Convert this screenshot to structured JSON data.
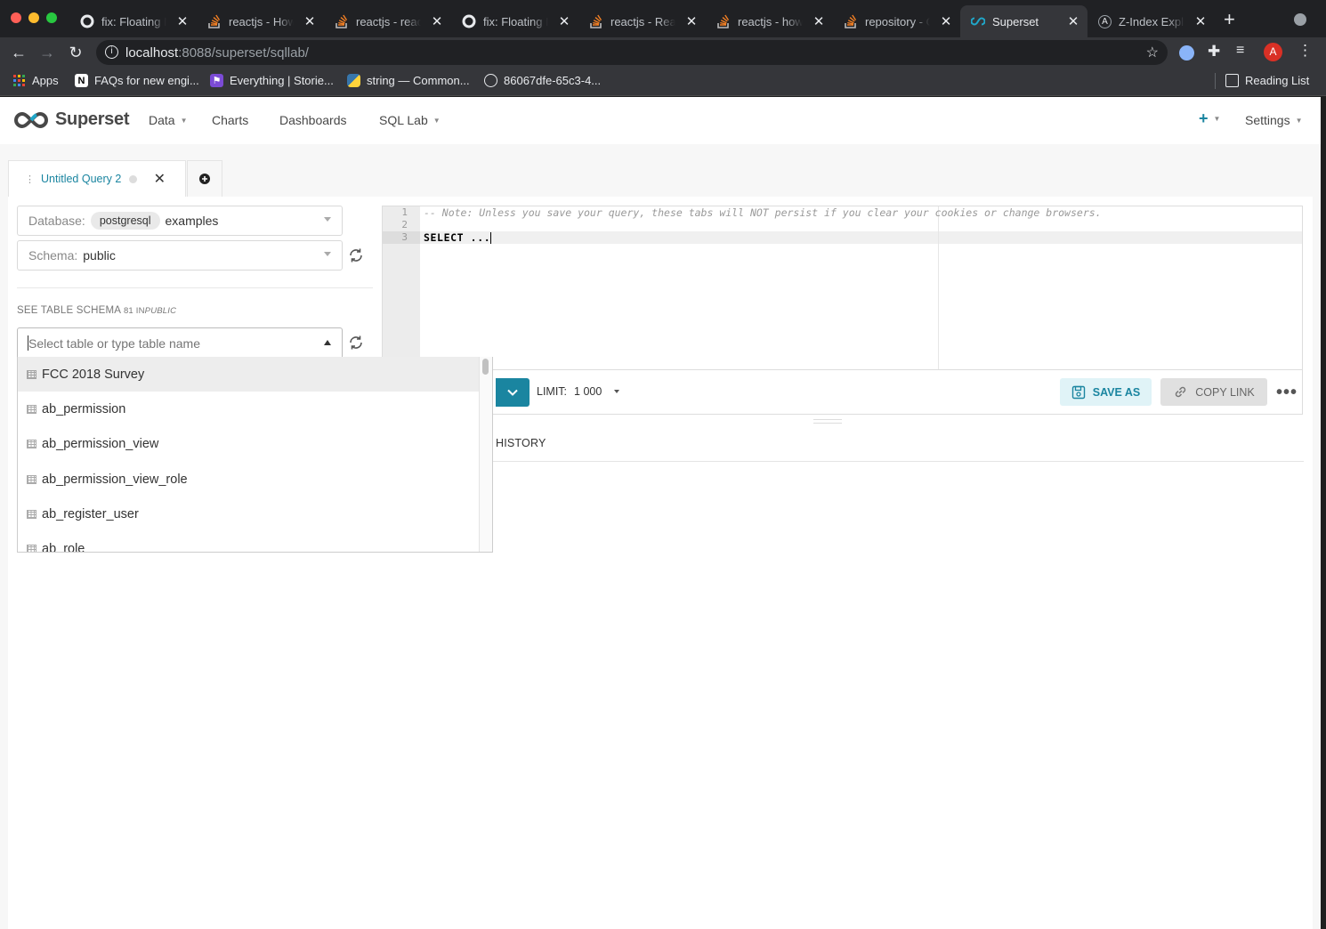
{
  "browser": {
    "tabs": [
      {
        "title": "fix: Floating M",
        "icon": "github-icon"
      },
      {
        "title": "reactjs - How",
        "icon": "stackoverflow-icon"
      },
      {
        "title": "reactjs - react",
        "icon": "stackoverflow-icon"
      },
      {
        "title": "fix: Floating M",
        "icon": "github-icon"
      },
      {
        "title": "reactjs - Reac",
        "icon": "stackoverflow-icon"
      },
      {
        "title": "reactjs - how",
        "icon": "stackoverflow-icon"
      },
      {
        "title": "repository - G",
        "icon": "stackoverflow-icon"
      },
      {
        "title": "Superset",
        "icon": "superset-icon",
        "active": true
      },
      {
        "title": "Z-Index Expla",
        "icon": "site-icon"
      }
    ],
    "url_host": "localhost",
    "url_rest": ":8088/superset/sqllab/",
    "profile_initial": "A",
    "bookmarks": [
      {
        "label": "Apps"
      },
      {
        "label": "FAQs for new engi..."
      },
      {
        "label": "Everything | Storie..."
      },
      {
        "label": "string — Common..."
      },
      {
        "label": "86067dfe-65c3-4..."
      }
    ],
    "reading_list": "Reading List"
  },
  "app": {
    "brand": "Superset",
    "nav": {
      "data": "Data",
      "charts": "Charts",
      "dashboards": "Dashboards",
      "sql_lab": "SQL Lab",
      "settings": "Settings"
    },
    "accent": "#1a85a0"
  },
  "query_tab": {
    "title": "Untitled Query 2"
  },
  "left": {
    "database_label": "Database:",
    "database_engine": "postgresql",
    "database_name": "examples",
    "schema_label": "Schema:",
    "schema_value": "public",
    "section_title": "SEE TABLE SCHEMA",
    "section_count": "81 IN",
    "section_schema": "PUBLIC",
    "table_placeholder": "Select table or type table name",
    "tables": [
      "FCC 2018 Survey",
      "ab_permission",
      "ab_permission_view",
      "ab_permission_view_role",
      "ab_register_user",
      "ab_role"
    ]
  },
  "editor": {
    "line_numbers": [
      "1",
      "2",
      "3"
    ],
    "line1": "-- Note: Unless you save your query, these tabs will NOT persist if you clear your cookies or change browsers.",
    "line3": "SELECT ..."
  },
  "actions": {
    "limit_label": "LIMIT:",
    "limit_value": "1 000",
    "save_as": "SAVE AS",
    "copy_link": "COPY LINK"
  },
  "results": {
    "history_tab": "HISTORY"
  }
}
